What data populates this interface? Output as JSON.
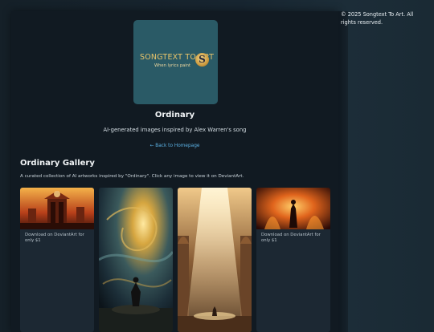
{
  "footer": {
    "text": "© 2025 Songtext To Art. All rights reserved."
  },
  "logo": {
    "main": "SONGTEXT TO ART",
    "sub": "When lyrics paint",
    "badge": "S"
  },
  "page": {
    "title": "Ordinary",
    "subtitle": "AI-generated images inspired by Alex Warren's song",
    "back_link": "← Back to Homepage"
  },
  "gallery": {
    "title": "Ordinary Gallery",
    "description": "A curated collection of AI artworks inspired by \"Ordinary\". Click any image to view it on DeviantArt.",
    "cards": [
      {
        "caption": "Download on DeviantArt for only $1"
      },
      {
        "caption": ""
      },
      {
        "caption": ""
      },
      {
        "caption": "Download on DeviantArt for only $1"
      }
    ]
  },
  "colors": {
    "link": "#5cb3e6",
    "panel": "#111a22",
    "logo_bg": "#2a5a66",
    "gold": "#e8c46a"
  }
}
